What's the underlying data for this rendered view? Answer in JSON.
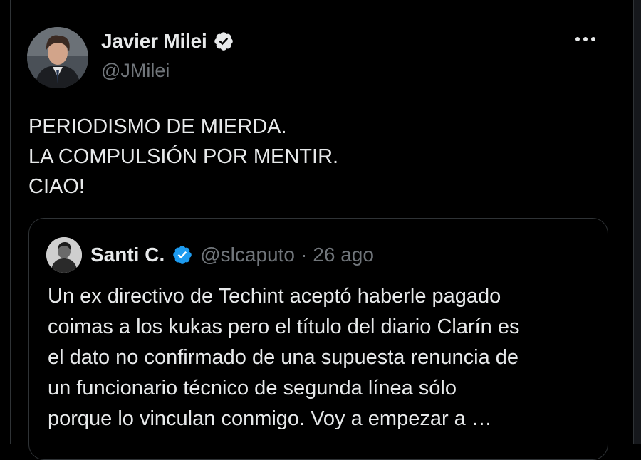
{
  "tweet": {
    "author": {
      "name": "Javier Milei",
      "handle": "@JMilei",
      "verified_icon": "verified-badge-icon",
      "verified_color": "#1d9bf0"
    },
    "more_icon": "more-icon",
    "text_lines": [
      "PERIODISMO DE MIERDA.",
      "LA COMPULSIÓN POR MENTIR.",
      "CIAO!"
    ]
  },
  "quoted_tweet": {
    "author": {
      "name": "Santi C.",
      "handle": "@slcaputo",
      "verified_icon": "verified-badge-icon"
    },
    "separator": "·",
    "date": "26 ago",
    "text_lines": [
      "Un ex directivo de Techint aceptó haberle pagado",
      "coimas a los kukas pero el título del diario Clarín es",
      "el dato no confirmado de una supuesta renuncia de",
      "un funcionario técnico de segunda línea sólo",
      "porque lo vinculan conmigo. Voy a empezar a …"
    ]
  },
  "colors": {
    "background": "#000000",
    "text": "#e7e9ea",
    "secondary_text": "#71767b",
    "border": "#2f3336",
    "accent": "#1d9bf0"
  }
}
